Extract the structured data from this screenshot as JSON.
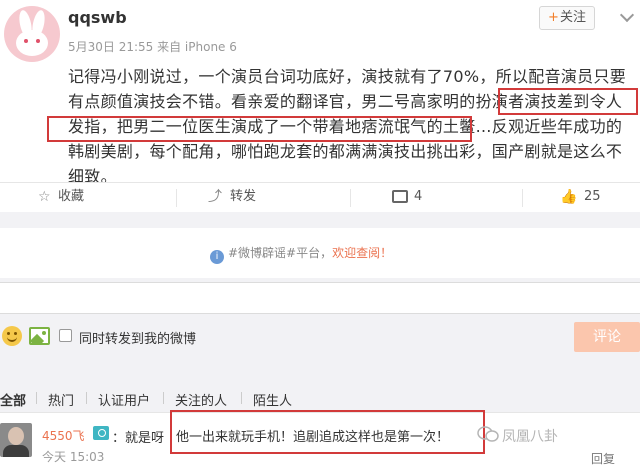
{
  "post": {
    "username": "qqswb",
    "meta": "5月30日 21:55 来自 iPhone 6",
    "follow_label": "关注",
    "text": "记得冯小刚说过，一个演员台词功底好，演技就有了70%，所以配音演员只要有点颜值演技会不错。看亲爱的翻译官，男二号高家明的扮演者演技差到令人发指，把男二一位医生演成了一个带着地痞流氓气的土鳖…反观近些年成功的韩剧美剧，每个配角，哪怕跑龙套的都满满演技出挑出彩，国产剧就是这么不细致。"
  },
  "actions": {
    "favorite": "收藏",
    "repost": "转发",
    "comment_count": "4",
    "like_count": "25"
  },
  "notice": {
    "tag": "#微博辟谣#平台，",
    "link": "欢迎查阅！"
  },
  "compose": {
    "also_repost_label": "同时转发到我的微博",
    "submit_label": "评论"
  },
  "filters": [
    "全部",
    "热门",
    "认证用户",
    "关注的人",
    "陌生人"
  ],
  "comment": {
    "user": "4550飞",
    "text_prefix": "：就是呀",
    "highlighted_text": "他一出来就玩手机！追剧追成这样也是第一次！",
    "time": "今天 15:03",
    "reply_label": "回复"
  },
  "watermark": "凤凰八卦",
  "colors": {
    "accent": "#eb7350",
    "highlight_box": "#d23a3a",
    "submit_bg": "#fbc6ad"
  }
}
